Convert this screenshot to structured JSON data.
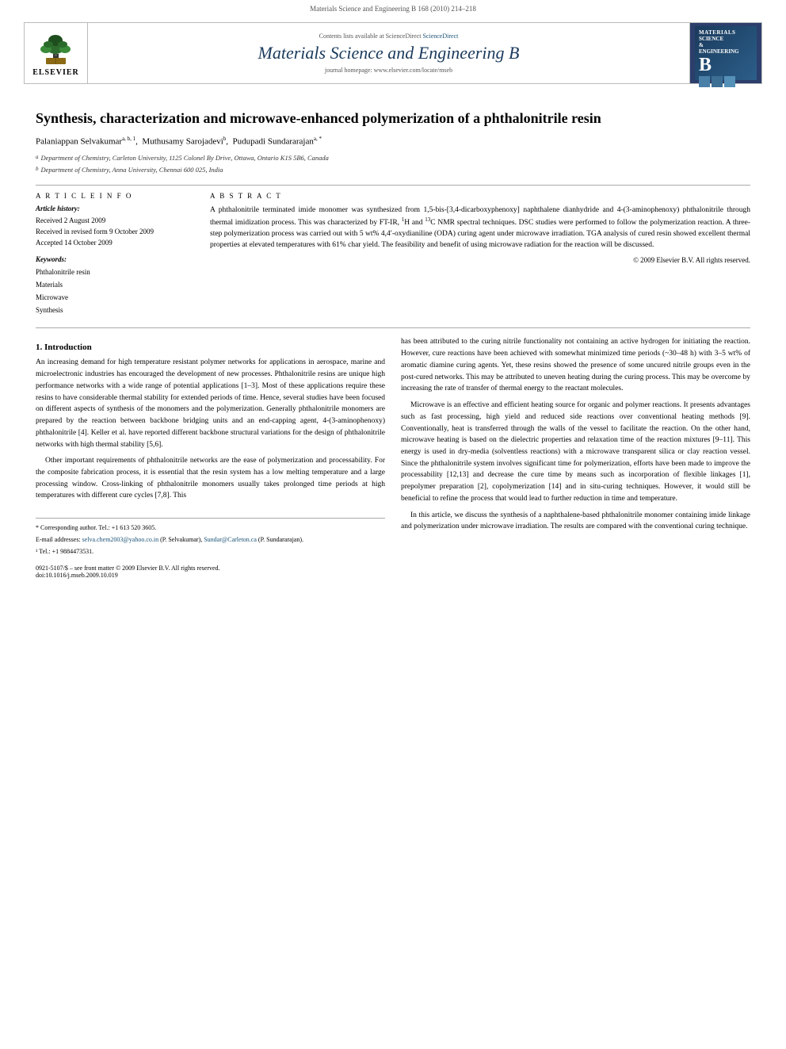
{
  "top_bar": {
    "citation": "Materials Science and Engineering B 168 (2010) 214–218"
  },
  "journal_header": {
    "sciencedirect_text": "Contents lists available at ScienceDirect",
    "sciencedirect_link": "ScienceDirect",
    "journal_title": "Materials Science and Engineering B",
    "homepage_text": "journal homepage: www.elsevier.com/locate/mseb",
    "homepage_url": "www.elsevier.com/locate/mseb",
    "badge_line1": "MATERIALS",
    "badge_line2": "SCIENCE",
    "badge_line3": "&",
    "badge_line4": "ENGINEERING",
    "badge_b": "B"
  },
  "article": {
    "title": "Synthesis, characterization and microwave-enhanced polymerization of a phthalonitrile resin",
    "authors": [
      {
        "name": "Palaniappan Selvakumar",
        "sup": "a, b, 1"
      },
      {
        "name": "Muthusamy Sarojadevi",
        "sup": "b"
      },
      {
        "name": "Pudupadi Sundararajan",
        "sup": "a, *"
      }
    ],
    "affiliations": [
      {
        "sup": "a",
        "text": "Department of Chemistry, Carleton University, 1125 Colonel By Drive, Ottawa, Ontario K1S 5B6, Canada"
      },
      {
        "sup": "b",
        "text": "Department of Chemistry, Anna University, Chennai 600 025, India"
      }
    ]
  },
  "article_info": {
    "section_header": "A R T I C L E   I N F O",
    "history_label": "Article history:",
    "received": "Received 2 August 2009",
    "revised": "Received in revised form 9 October 2009",
    "accepted": "Accepted 14 October 2009",
    "keywords_label": "Keywords:",
    "keywords": [
      "Phthalonitrile resin",
      "Materials",
      "Microwave",
      "Synthesis"
    ]
  },
  "abstract": {
    "section_header": "A B S T R A C T",
    "text": "A phthalonitrile terminated imide monomer was synthesized from 1,5-bis-[3,4-dicarboxyphenoxy] naphthalene dianhydride and 4-(3-aminophenoxy) phthalonitrile through thermal imidization process. This was characterized by FT-IR, ¹H and ¹³C NMR spectral techniques. DSC studies were performed to follow the polymerization reaction. A three-step polymerization process was carried out with 5 wt% 4,4′-oxydianiline (ODA) curing agent under microwave irradiation. TGA analysis of cured resin showed excellent thermal properties at elevated temperatures with 61% char yield. The feasibility and benefit of using microwave radiation for the reaction will be discussed.",
    "copyright": "© 2009 Elsevier B.V. All rights reserved."
  },
  "section1": {
    "title": "1.  Introduction",
    "paragraphs": [
      "An increasing demand for high temperature resistant polymer networks for applications in aerospace, marine and microelectronic industries has encouraged the development of new processes. Phthalonitrile resins are unique high performance networks with a wide range of potential applications [1–3]. Most of these applications require these resins to have considerable thermal stability for extended periods of time. Hence, several studies have been focused on different aspects of synthesis of the monomers and the polymerization. Generally phthalonitrile monomers are prepared by the reaction between backbone bridging units and an end-capping agent, 4-(3-aminophenoxy) phthalonitrile [4]. Keller et al. have reported different backbone structural variations for the design of phthalonitrile networks with high thermal stability [5,6].",
      "Other important requirements of phthalonitrile networks are the ease of polymerization and processability. For the composite fabrication process, it is essential that the resin system has a low melting temperature and a large processing window. Cross-linking of phthalonitrile monomers usually takes prolonged time periods at high temperatures with different cure cycles [7,8]. This",
      "has been attributed to the curing nitrile functionality not containing an active hydrogen for initiating the reaction. However, cure reactions have been achieved with somewhat minimized time periods (~30–48 h) with 3–5 wt% of aromatic diamine curing agents. Yet, these resins showed the presence of some uncured nitrile groups even in the post-cured networks. This may be attributed to uneven heating during the curing process. This may be overcome by increasing the rate of transfer of thermal energy to the reactant molecules.",
      "Microwave is an effective and efficient heating source for organic and polymer reactions. It presents advantages such as fast processing, high yield and reduced side reactions over conventional heating methods [9]. Conventionally, heat is transferred through the walls of the vessel to facilitate the reaction. On the other hand, microwave heating is based on the dielectric properties and relaxation time of the reaction mixtures [9–11]. This energy is used in dry-media (solventless reactions) with a microwave transparent silica or clay reaction vessel. Since the phthalonitrile system involves significant time for polymerization, efforts have been made to improve the processability [12,13] and decrease the cure time by means such as incorporation of flexible linkages [1], prepolymer preparation [2], copolymerization [14] and in situ-curing techniques. However, it would still be beneficial to refine the process that would lead to further reduction in time and temperature.",
      "In this article, we discuss the synthesis of a naphthalene-based phthalonitrile monomer containing imide linkage and polymerization under microwave irradiation. The results are compared with the conventional curing technique."
    ]
  },
  "footnotes": {
    "corresponding": "* Corresponding author. Tel.: +1 613 520 3605.",
    "email_label": "E-mail addresses:",
    "email1": "selva.chem2003@yahoo.co.in",
    "email1_name": "(P. Selvakumar),",
    "email2": "Sundar@Carleton.ca",
    "email2_name": "(P. Sundararajan).",
    "note1": "¹ Tel.: +1 9884473531."
  },
  "bottom_info": {
    "line1": "0921-5107/$ – see front matter © 2009 Elsevier B.V. All rights reserved.",
    "line2": "doi:10.1016/j.mseb.2009.10.019"
  },
  "elsevier": {
    "logo_text": "ELSEVIER"
  }
}
